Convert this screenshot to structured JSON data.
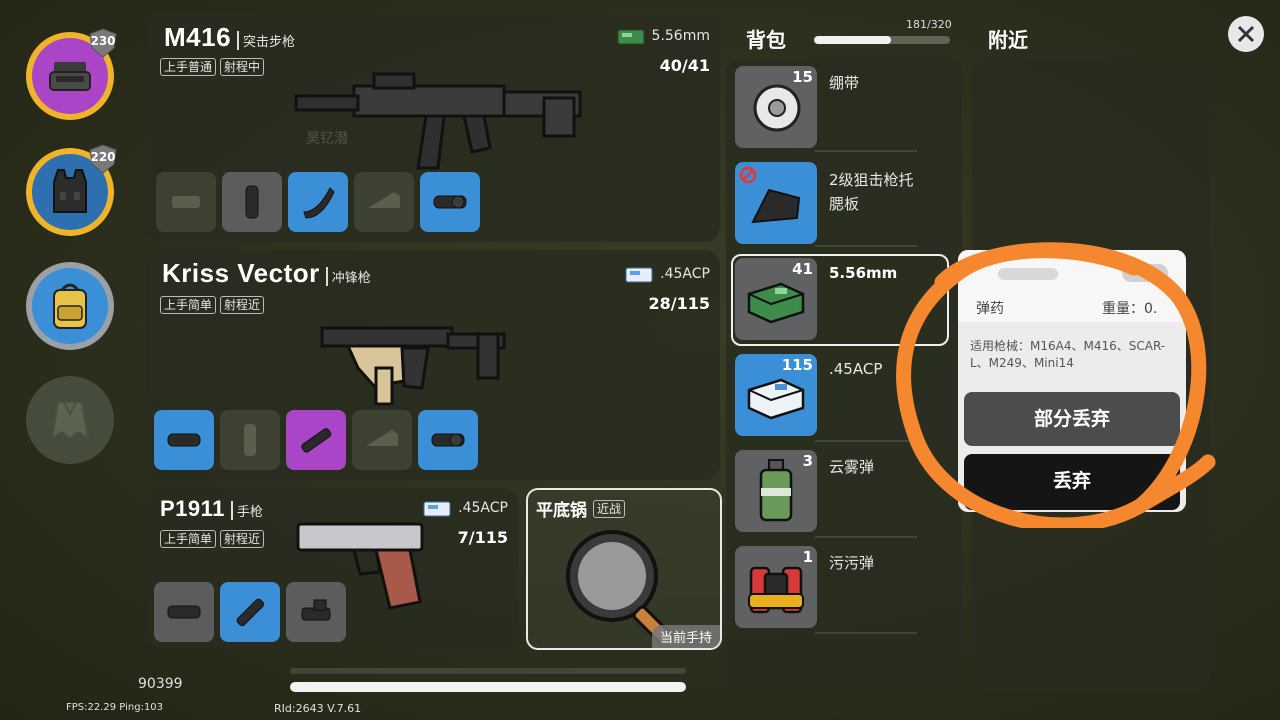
{
  "left_panel": {
    "helmet_durability": "230",
    "vest_durability": "220",
    "colors": {
      "purple": "#a945c6",
      "gold": "#f0b429",
      "blue": "#3a8fd6"
    }
  },
  "weapons": [
    {
      "name": "M416",
      "type": "突击步枪",
      "tags": [
        "上手普通",
        "射程中"
      ],
      "ammo_type": "5.56mm",
      "ammo_count": "40/41",
      "watermark": "昊钇潜"
    },
    {
      "name": "Kriss Vector",
      "type": "冲锋枪",
      "tags": [
        "上手简单",
        "射程近"
      ],
      "ammo_type": ".45ACP",
      "ammo_count": "28/115"
    },
    {
      "name": "P1911",
      "type": "手枪",
      "tags": [
        "上手简单",
        "射程近"
      ],
      "ammo_type": ".45ACP",
      "ammo_count": "7/115"
    }
  ],
  "melee": {
    "name": "平底锅",
    "tag": "近战",
    "current_label": "当前手持"
  },
  "backpack": {
    "title": "背包",
    "capacity": "181/320",
    "capacity_fraction": 0.566,
    "items": [
      {
        "label": "绷带",
        "count": "15",
        "icon": "bandage-icon"
      },
      {
        "label": "2级狙击枪托腮板",
        "count": "",
        "icon": "cheek-pad-icon"
      },
      {
        "label": "5.56mm",
        "count": "41",
        "icon": "ammo-box-icon"
      },
      {
        "label": ".45ACP",
        "count": "115",
        "icon": "ammo-box-icon"
      },
      {
        "label": "云雾弹",
        "count": "3",
        "icon": "smoke-grenade-icon"
      },
      {
        "label": "污污弹",
        "count": "1",
        "icon": "stink-bomb-icon"
      }
    ]
  },
  "nearby": {
    "title": "附近"
  },
  "popup": {
    "category": "弹药",
    "weight_label": "重量：0.",
    "compatible_label": "适用枪械：",
    "compatible_list": "M16A4、M416、SCAR-L、M249、Mini14",
    "partial_drop_button": "部分丢弃",
    "drop_button": "丢弃"
  },
  "footer": {
    "id_number": "90399",
    "fps_ping": "FPS:22.29 Ping:103",
    "rid_version": "RId:2643 V.7.61"
  },
  "annotation_color": "#f5872f"
}
